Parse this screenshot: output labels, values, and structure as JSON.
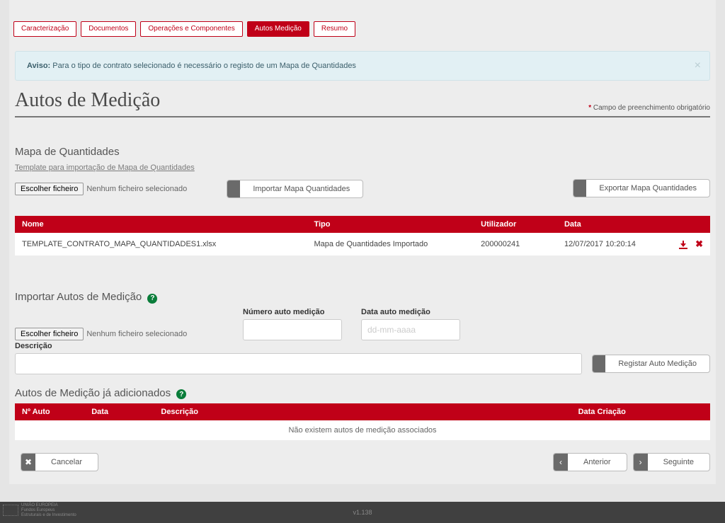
{
  "tabs": [
    "Caracterização",
    "Documentos",
    "Operações e Componentes",
    "Autos Medição",
    "Resumo"
  ],
  "active_tab": 3,
  "alert": {
    "bold": "Aviso:",
    "text": " Para o tipo de contrato selecionado é necessário o registo de um Mapa de Quantidades"
  },
  "page_title": "Autos de Medição",
  "required_note": "Campo de preenchimento obrigatório",
  "sections": {
    "map": {
      "title": "Mapa de Quantidades",
      "template_link": "Template para importação de Mapa de Quantidades",
      "file_btn": "Escolher ficheiro",
      "file_text": "Nenhum ficheiro selecionado",
      "import_btn": "Importar Mapa Quantidades",
      "export_btn": "Exportar Mapa Quantidades",
      "headers": [
        "Nome",
        "Tipo",
        "Utilizador",
        "Data"
      ],
      "row": {
        "nome": "TEMPLATE_CONTRATO_MAPA_QUANTIDADES1.xlsx",
        "tipo": "Mapa de Quantidades Importado",
        "utilizador": "200000241",
        "data": "12/07/2017 10:20:14"
      }
    },
    "import_autos": {
      "title": "Importar Autos de Medição",
      "file_btn": "Escolher ficheiro",
      "file_text": "Nenhum ficheiro selecionado",
      "num_label": "Número auto medição",
      "date_label": "Data auto medição",
      "date_placeholder": "dd-mm-aaaa",
      "desc_label": "Descrição",
      "register_btn": "Registar Auto Medição"
    },
    "added": {
      "title": "Autos de Medição já adicionados",
      "headers": [
        "Nº Auto",
        "Data",
        "Descrição",
        "Data Criação"
      ],
      "empty": "Não existem autos de medição associados"
    }
  },
  "nav": {
    "cancel": "Cancelar",
    "prev": "Anterior",
    "next": "Seguinte"
  },
  "footer": {
    "version": "v1.138",
    "line1": "UNIÃO EUROPEIA",
    "line2": "Fundos Europeus",
    "line3": "Estruturais e de Investimento"
  }
}
